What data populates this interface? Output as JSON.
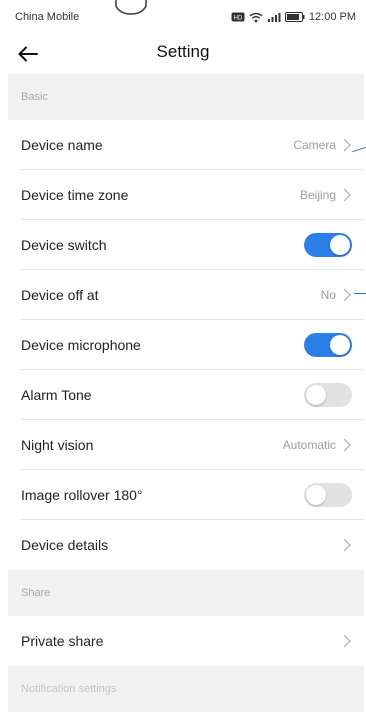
{
  "status_bar": {
    "carrier": "China Mobile",
    "time": "12:00 PM",
    "icons": [
      "hd-icon",
      "wifi-icon",
      "signal-icon",
      "battery-icon"
    ]
  },
  "header": {
    "title": "Setting",
    "back_icon": "arrow-left-icon"
  },
  "sections": {
    "basic": "Basic",
    "share": "Share",
    "notification": "Notification settings"
  },
  "rows": {
    "device_name": {
      "label": "Device name",
      "value": "Camera"
    },
    "device_time_zone": {
      "label": "Device time zone",
      "value": "Beijing"
    },
    "device_switch": {
      "label": "Device switch",
      "on": true
    },
    "device_off_at": {
      "label": "Device off at",
      "value": "No"
    },
    "device_microphone": {
      "label": "Device microphone",
      "on": true
    },
    "alarm_tone": {
      "label": "Alarm Tone",
      "on": false
    },
    "night_vision": {
      "label": "Night vision",
      "value": "Automatic"
    },
    "image_rollover": {
      "label": "Image rollover 180°",
      "on": false
    },
    "device_details": {
      "label": "Device details"
    },
    "private_share": {
      "label": "Private share"
    }
  },
  "colors": {
    "accent": "#2b7fe8",
    "section_bg": "#f1f1f1",
    "value_text": "#9c9c9c"
  }
}
